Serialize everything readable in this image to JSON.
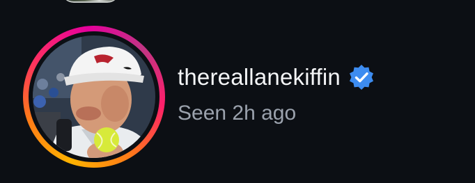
{
  "profile": {
    "username": "thereallanekiffin",
    "verified_icon": "verified-badge-icon",
    "status": "Seen 2h ago",
    "ring_gradient": [
      "#ffb300",
      "#ff7a18",
      "#ff2e63",
      "#e6009c"
    ],
    "verified_color": "#3d8cf0"
  },
  "theme": {
    "background": "#0c0f14",
    "text_primary": "#f4f5f7",
    "text_secondary": "#9ba2ad"
  }
}
